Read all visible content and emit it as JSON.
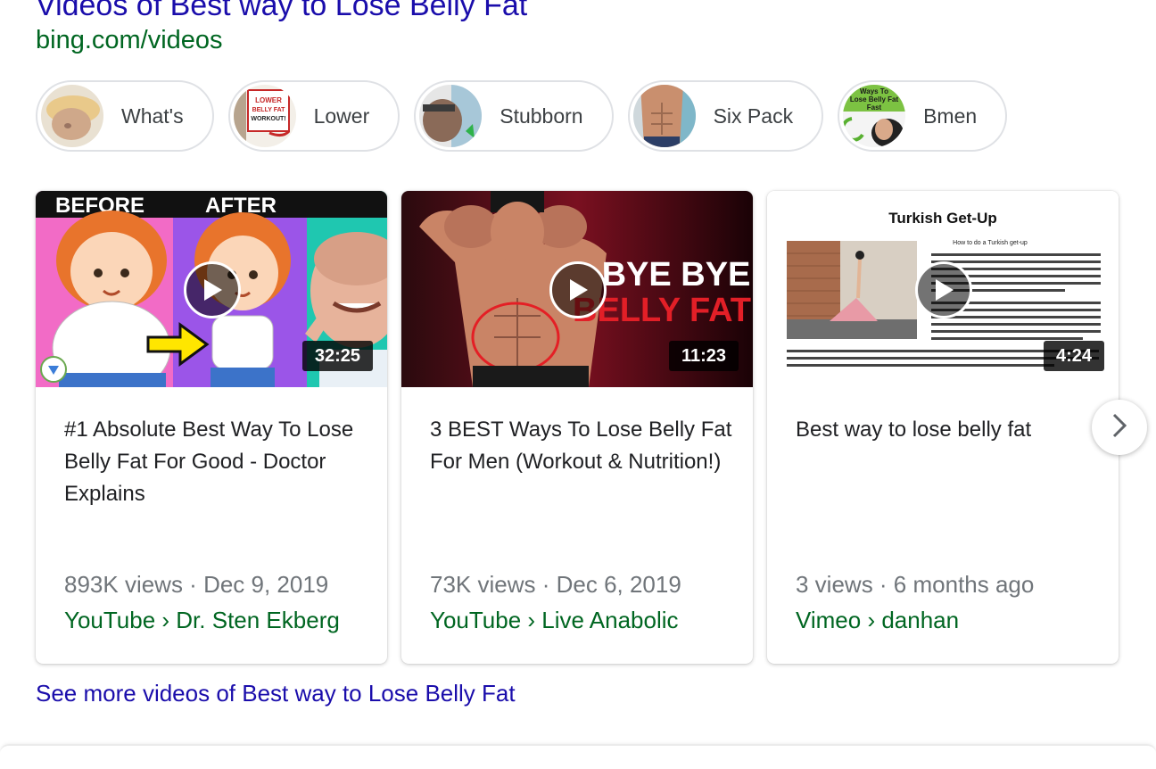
{
  "header": {
    "title": "Videos of Best way to Lose Belly Fat",
    "source": "bing.com/videos"
  },
  "chips": [
    {
      "label": "What's",
      "icon": "belly-thumbnail"
    },
    {
      "label": "Lower",
      "icon": "lower-belly-fat-workout-thumbnail",
      "thumb_text": "LOWER BELLY FAT WORKOUT!"
    },
    {
      "label": "Stubborn",
      "icon": "stubborn-fat-thumbnail"
    },
    {
      "label": "Six Pack",
      "icon": "six-pack-thumbnail"
    },
    {
      "label": "Bmen",
      "icon": "ways-to-lose-belly-fat-thumbnail",
      "thumb_text": "Ways To Lose Belly Fat Fast"
    }
  ],
  "videos": [
    {
      "title": "#1 Absolute Best Way To Lose Belly Fat For Good - Doctor Explains",
      "duration": "32:25",
      "meta": "893K views · Dec 9, 2019",
      "source": "YouTube › Dr. Sten Ekberg",
      "thumb_text_left": "BEFORE",
      "thumb_text_right": "AFTER"
    },
    {
      "title": "3 BEST Ways To Lose Belly Fat For Men (Workout & Nutrition!)",
      "duration": "11:23",
      "meta": "73K views · Dec 6, 2019",
      "source": "YouTube › Live Anabolic",
      "thumb_text_line1": "BYE BYE",
      "thumb_text_line2": "BELLY FAT"
    },
    {
      "title": "Best way to lose belly fat",
      "duration": "4:24",
      "meta": "3 views · 6 months ago",
      "source": "Vimeo › danhan",
      "thumb_heading": "Turkish Get-Up",
      "thumb_subheading": "How to do a Turkish get-up"
    }
  ],
  "see_more": "See more videos of Best way to Lose Belly Fat",
  "colors": {
    "link": "#1a0dab",
    "url_green": "#006621",
    "meta_gray": "#70757a"
  }
}
